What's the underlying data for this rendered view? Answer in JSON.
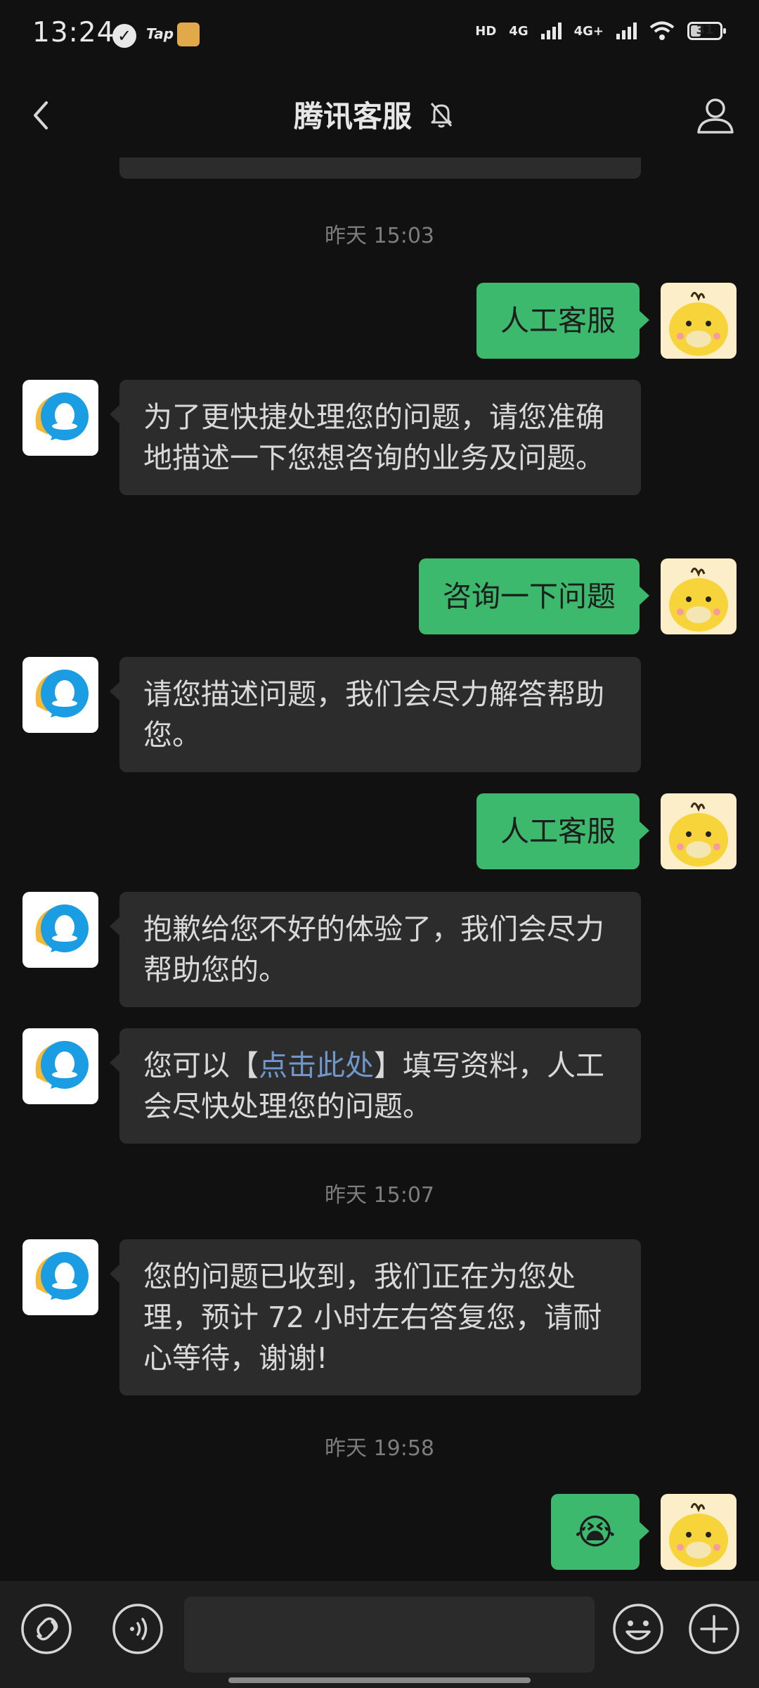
{
  "status_bar": {
    "time": "13:24",
    "tap_label": "Tap",
    "network_1": "4G",
    "network_2": "4G+",
    "hd_label": "HD",
    "battery_level": "31"
  },
  "nav": {
    "title": "腾讯客服",
    "back_icon": "chevron-left-icon",
    "mute_icon": "bell-off-icon",
    "profile_icon": "person-icon"
  },
  "messages": [
    {
      "type": "timestamp",
      "text": "昨天 15:03"
    },
    {
      "type": "out",
      "text": "人工客服"
    },
    {
      "type": "in",
      "text": "为了更快捷处理您的问题，请您准确地描述一下您想咨询的业务及问题。"
    },
    {
      "type": "out",
      "text": "咨询一下问题"
    },
    {
      "type": "in",
      "text": "请您描述问题，我们会尽力解答帮助您。"
    },
    {
      "type": "out",
      "text": "人工客服"
    },
    {
      "type": "in",
      "text": "抱歉给您不好的体验了，我们会尽力帮助您的。"
    },
    {
      "type": "in_link",
      "before": "您可以【",
      "link": "点击此处",
      "after": "】填写资料，人工会尽快处理您的问题。"
    },
    {
      "type": "timestamp",
      "text": "昨天 15:07"
    },
    {
      "type": "in",
      "text": "您的问题已收到，我们正在为您处理，预计 72 小时左右答复您，请耐心等待，谢谢!"
    },
    {
      "type": "timestamp",
      "text": "昨天 19:58"
    },
    {
      "type": "out_emoji",
      "emoji": "😭"
    }
  ],
  "input_bar": {
    "left_icon": "link-icon",
    "voice_icon": "voice-icon",
    "emoji_icon": "smiley-icon",
    "add_icon": "plus-icon",
    "text_value": ""
  },
  "colors": {
    "background": "#111111",
    "incoming_bubble": "#2c2c2c",
    "outgoing_bubble": "#3cb96c",
    "link": "#6f97c9"
  }
}
